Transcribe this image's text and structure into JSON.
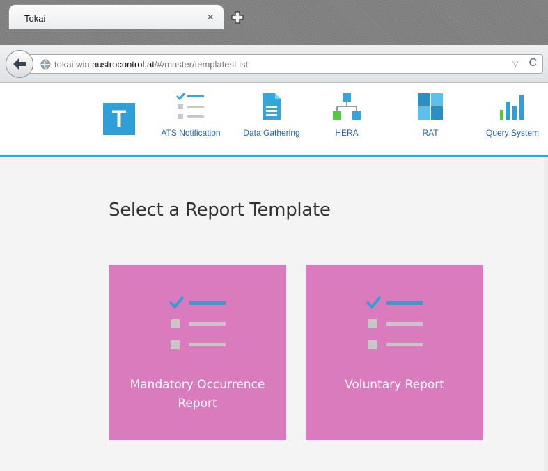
{
  "browser": {
    "tab_title": "Tokai",
    "tab_close_glyph": "×",
    "url_prefix": "tokai.win.",
    "url_host": "austrocontrol.at",
    "url_path": "/#/master/templatesList",
    "dropmarker_glyph": "▽",
    "reload_glyph": "C"
  },
  "app": {
    "logo_letter": "T",
    "nav": [
      {
        "label": "ATS Notification",
        "icon": "checklist-icon"
      },
      {
        "label": "Data Gathering",
        "icon": "document-icon"
      },
      {
        "label": "HERA",
        "icon": "hierarchy-icon"
      },
      {
        "label": "RAT",
        "icon": "tiles-icon"
      },
      {
        "label": "Query System",
        "icon": "bar-chart-icon"
      }
    ]
  },
  "main": {
    "title": "Select a Report Template",
    "cards": [
      {
        "line1": "Mandatory Occurrence",
        "line2": "Report",
        "icon": "checklist-icon"
      },
      {
        "line1": "Voluntary Report",
        "line2": "",
        "icon": "checklist-icon"
      }
    ]
  },
  "colors": {
    "accent_blue": "#33a7dd",
    "card_pink": "#d97bbd",
    "nav_label": "#1f64b5",
    "hera_green": "#57c83a"
  }
}
